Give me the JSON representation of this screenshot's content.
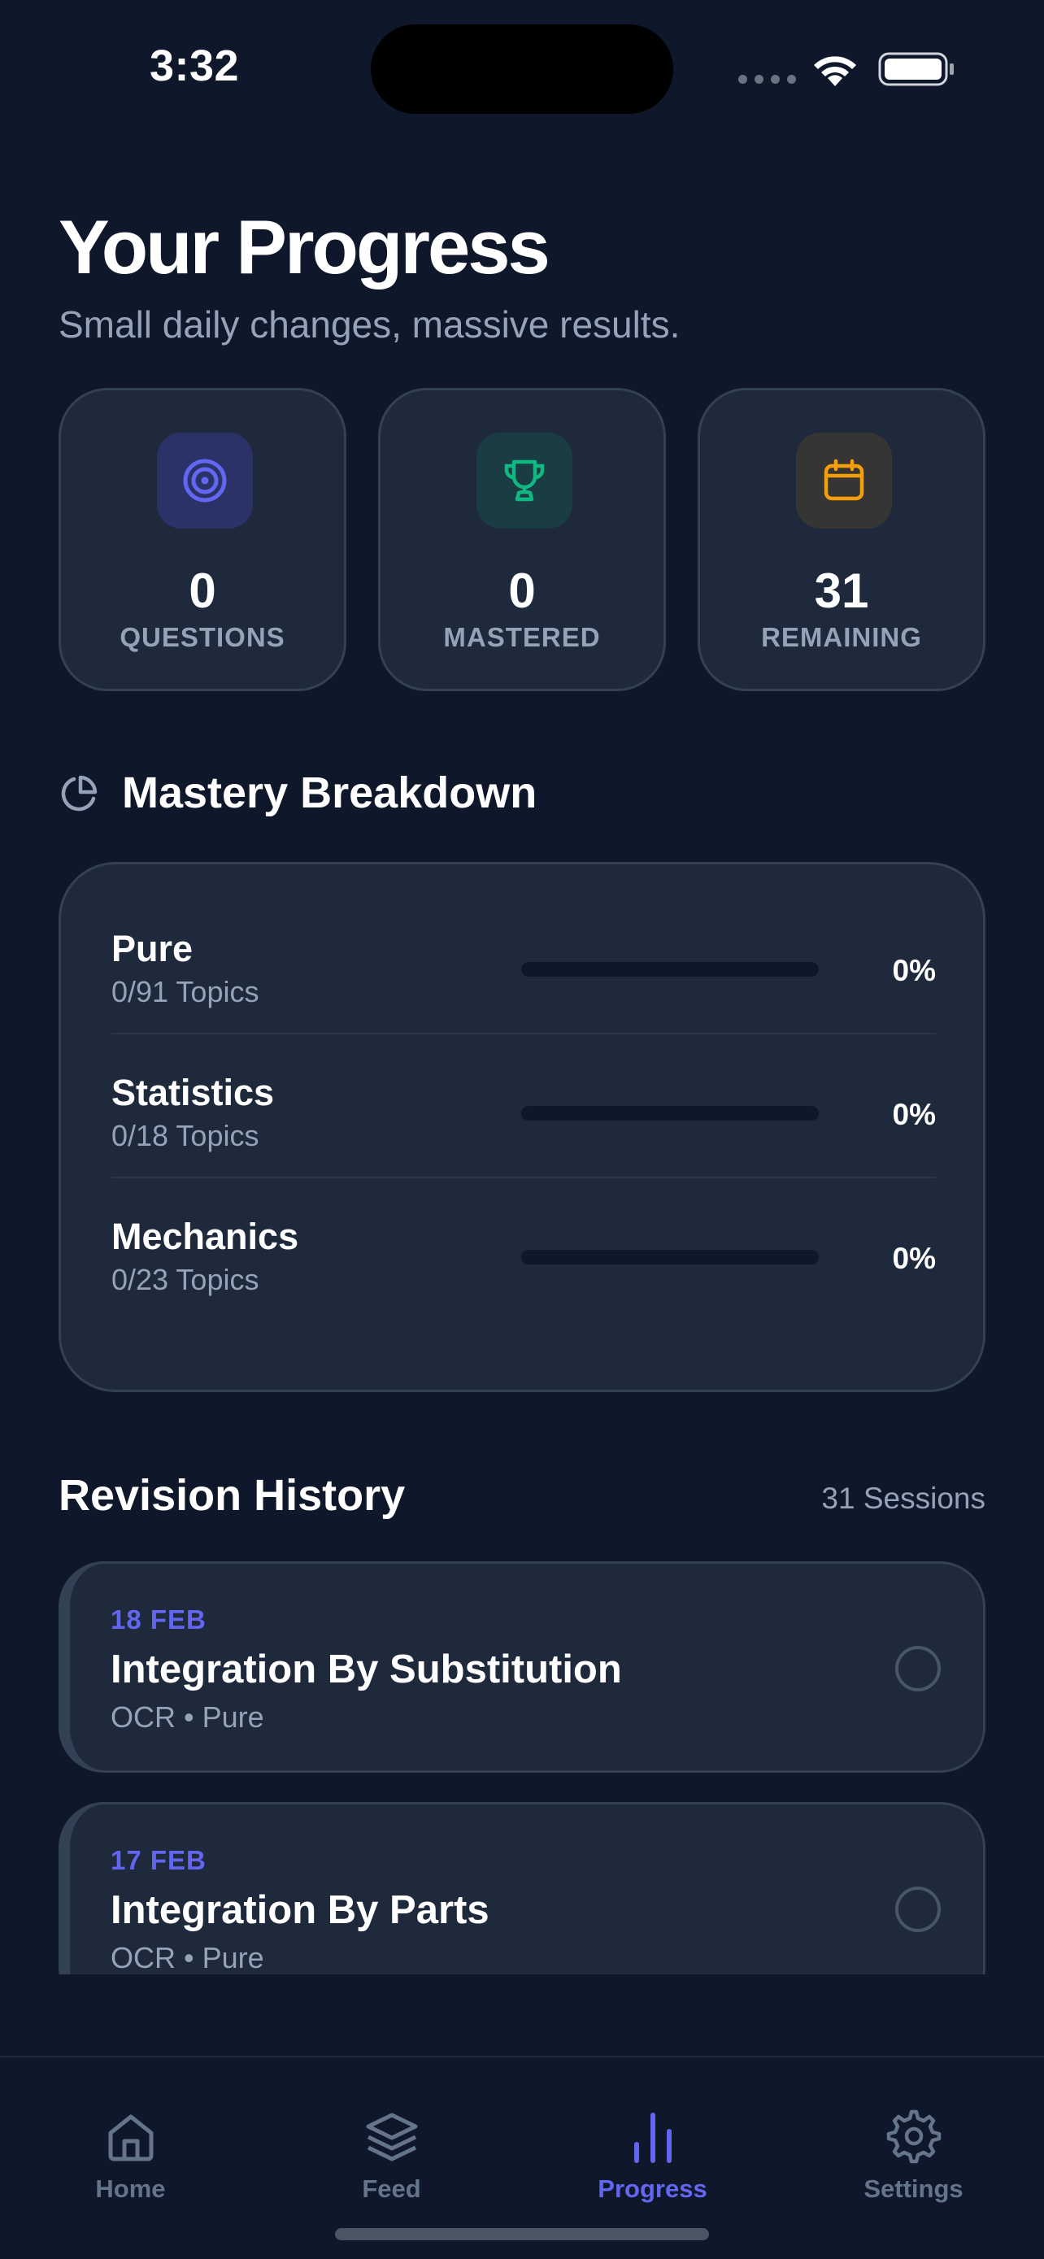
{
  "status_bar": {
    "time": "3:32"
  },
  "header": {
    "title": "Your Progress",
    "subtitle": "Small daily changes, massive results."
  },
  "stats": [
    {
      "icon": "target-icon",
      "value": "0",
      "label": "QUESTIONS",
      "accent": "#6366f1",
      "bg": "#2b3268"
    },
    {
      "icon": "trophy-icon",
      "value": "0",
      "label": "MASTERED",
      "accent": "#10b981",
      "bg": "#193d43"
    },
    {
      "icon": "calendar-icon",
      "value": "31",
      "label": "REMAINING",
      "accent": "#f59e0b",
      "bg": "#353634"
    }
  ],
  "mastery": {
    "title": "Mastery Breakdown",
    "icon": "pie-chart-icon",
    "rows": [
      {
        "name": "Pure",
        "topics": "0/91 Topics",
        "percent_label": "0%",
        "progress": 0
      },
      {
        "name": "Statistics",
        "topics": "0/18 Topics",
        "percent_label": "0%",
        "progress": 0
      },
      {
        "name": "Mechanics",
        "topics": "0/23 Topics",
        "percent_label": "0%",
        "progress": 0
      }
    ]
  },
  "history": {
    "title": "Revision History",
    "count": "31 Sessions",
    "sessions": [
      {
        "date": "18 FEB",
        "topic": "Integration By Substitution",
        "meta": "OCR • Pure",
        "done": false
      },
      {
        "date": "17 FEB",
        "topic": "Integration By Parts",
        "meta": "OCR • Pure",
        "done": false
      }
    ]
  },
  "tabs": [
    {
      "label": "Home",
      "icon": "home-icon",
      "active": false
    },
    {
      "label": "Feed",
      "icon": "layers-icon",
      "active": false
    },
    {
      "label": "Progress",
      "icon": "bar-chart-icon",
      "active": true
    },
    {
      "label": "Settings",
      "icon": "gear-icon",
      "active": false
    }
  ],
  "colors": {
    "accent": "#6366f1",
    "background": "#0f172a",
    "card": "#1e293b"
  }
}
